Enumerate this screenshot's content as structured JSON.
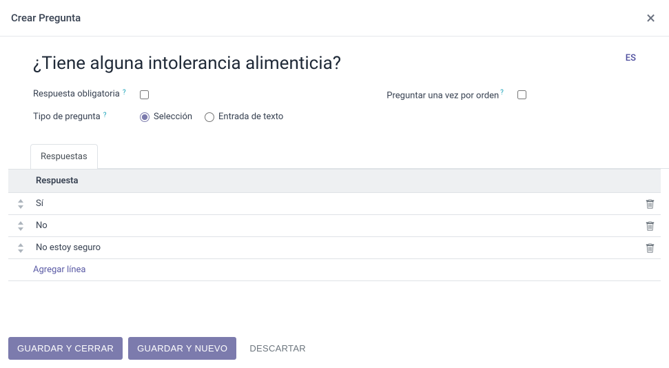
{
  "modal": {
    "title": "Crear Pregunta",
    "close_label": "×"
  },
  "form": {
    "lang": "ES",
    "question": "¿Tiene alguna intolerancia alimenticia?",
    "mandatory_label": "Respuesta obligatoria",
    "mandatory_checked": false,
    "ask_once_label": "Preguntar una vez por orden",
    "ask_once_checked": false,
    "type_label": "Tipo de pregunta",
    "type_options": {
      "selection": "Selección",
      "text_entry": "Entrada de texto"
    },
    "type_selected": "selection",
    "help_char": "?"
  },
  "tabs": {
    "responses": "Respuestas"
  },
  "table": {
    "header": "Respuesta",
    "rows": [
      {
        "text": "Sí"
      },
      {
        "text": "No"
      },
      {
        "text": "No estoy seguro"
      }
    ],
    "add_line": "Agregar línea"
  },
  "footer": {
    "save_close": "GUARDAR Y CERRAR",
    "save_new": "GUARDAR Y NUEVO",
    "discard": "DESCARTAR"
  }
}
